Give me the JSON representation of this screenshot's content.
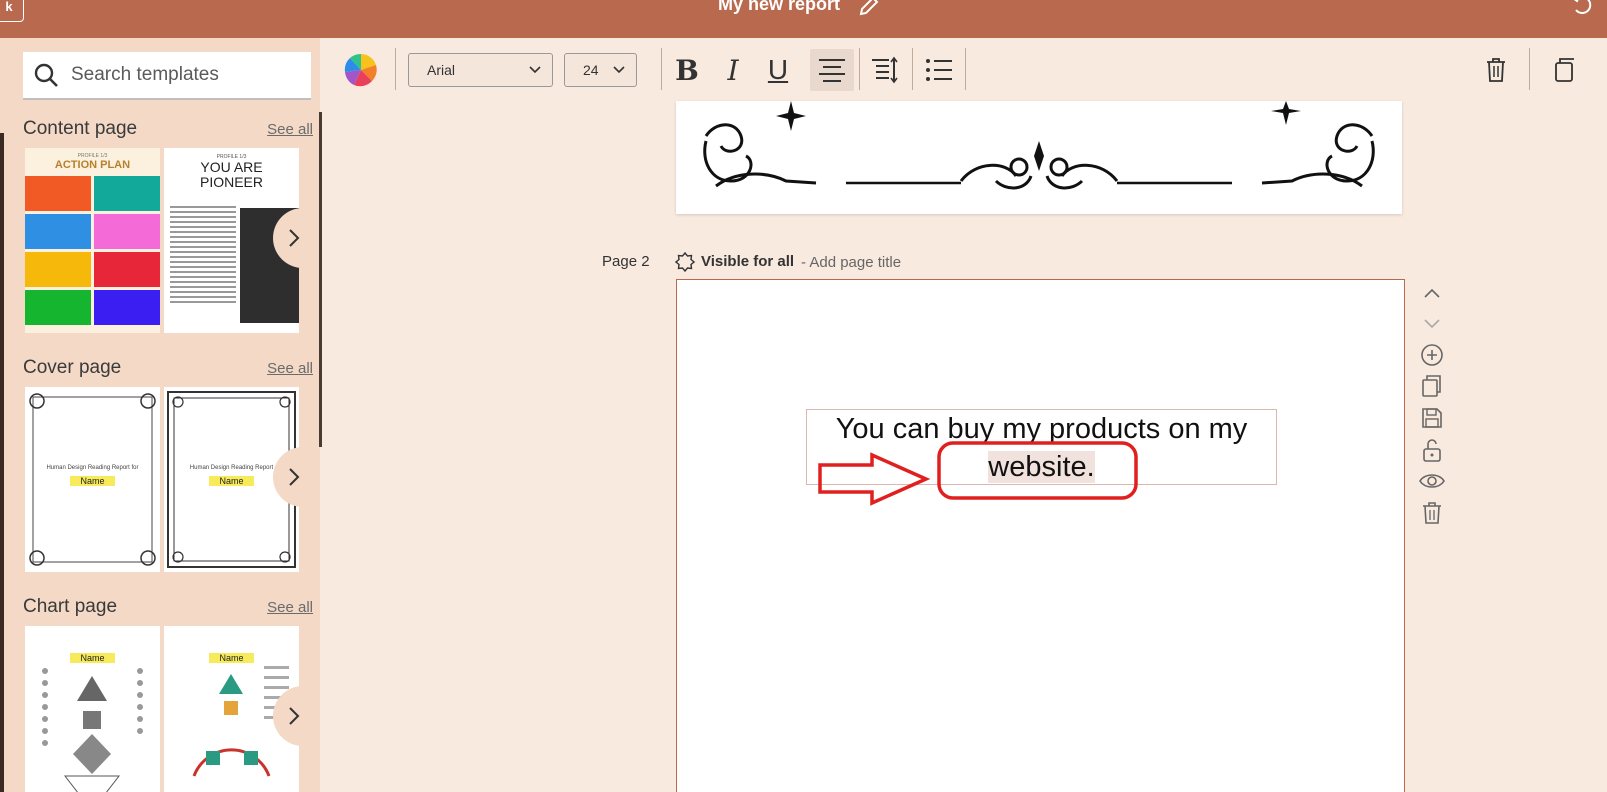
{
  "header": {
    "back_label": "k",
    "title": "My new report"
  },
  "sidebar": {
    "search_placeholder": "Search templates",
    "sections": [
      {
        "title": "Content page",
        "see_all": "See all",
        "thumbs": [
          {
            "subtitle": "PROFILE 1/3",
            "title": "ACTION PLAN"
          },
          {
            "subtitle": "PROFILE 1/3",
            "title_line1": "YOU ARE",
            "title_line2": "PIONEER"
          }
        ]
      },
      {
        "title": "Cover page",
        "see_all": "See all",
        "thumbs": [
          {
            "label": "Human Design Reading Report for",
            "name": "Name"
          },
          {
            "label": "Human Design Reading Report",
            "name": "Name"
          }
        ]
      },
      {
        "title": "Chart page",
        "see_all": "See all",
        "thumbs": [
          {
            "name": "Name"
          },
          {
            "name": "Name"
          }
        ]
      }
    ]
  },
  "toolbar": {
    "font_family": "Arial",
    "font_size": "24",
    "bold": "B",
    "italic": "I",
    "underline": "U"
  },
  "canvas": {
    "page2": {
      "label": "Page 2",
      "visibility": "Visible for all",
      "separator": "-",
      "title_placeholder": "Add page title",
      "text_line1": "You can buy my products on my",
      "text_line2": "website."
    }
  },
  "colors": {
    "header_bg": "#b8694e",
    "sidebar_bg": "#f3d9c6",
    "canvas_bg": "#f9eae0",
    "annotation_red": "#e0201e"
  }
}
